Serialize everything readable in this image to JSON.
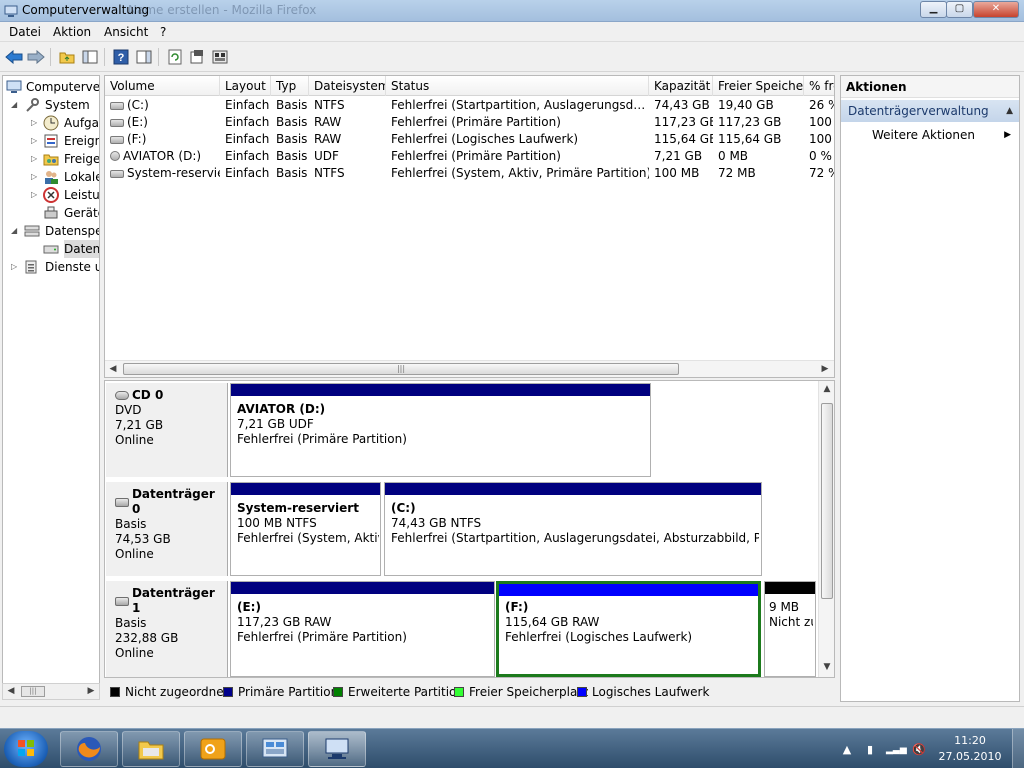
{
  "window": {
    "title": "Computerverwaltung",
    "title_ghost": "Name erstellen - Mozilla Firefox",
    "min_symbol": "▁",
    "max_symbol": "▢",
    "close_symbol": "✕"
  },
  "menu": [
    "Datei",
    "Aktion",
    "Ansicht",
    "?"
  ],
  "toolbar": {
    "icons": [
      "back-icon",
      "forward-icon",
      "up-folder-icon",
      "show-hide-tree-icon",
      "help-icon",
      "show-hide-action-pane-icon",
      "refresh-icon",
      "properties-icon",
      "console-icon"
    ]
  },
  "tree": {
    "items": [
      {
        "label": "Computerverwaltung (Lokal)",
        "icon": "computer-management-icon",
        "level": 0,
        "expander": ""
      },
      {
        "label": "System",
        "icon": "tools-icon",
        "level": 1,
        "expander": "◢"
      },
      {
        "label": "Aufgabenplanung",
        "icon": "clock-icon",
        "level": 2,
        "expander": "▷"
      },
      {
        "label": "Ereignisanzeige",
        "icon": "event-viewer-icon",
        "level": 2,
        "expander": "▷"
      },
      {
        "label": "Freigegebene Ordner",
        "icon": "shared-folder-icon",
        "level": 2,
        "expander": "▷"
      },
      {
        "label": "Lokale Benutzer und Gruppen",
        "icon": "users-icon",
        "level": 2,
        "expander": "▷"
      },
      {
        "label": "Leistung",
        "icon": "performance-icon",
        "level": 2,
        "expander": "▷"
      },
      {
        "label": "Geräte-Manager",
        "icon": "device-manager-icon",
        "level": 2,
        "expander": ""
      },
      {
        "label": "Datenspeicher",
        "icon": "storage-icon",
        "level": 1,
        "expander": "◢"
      },
      {
        "label": "Datenträgerverwaltung",
        "icon": "disk-management-icon",
        "level": 2,
        "expander": "",
        "selected": true
      },
      {
        "label": "Dienste und Anwendungen",
        "icon": "services-icon",
        "level": 1,
        "expander": "▷"
      }
    ]
  },
  "volume_list": {
    "columns": [
      "Volume",
      "Layout",
      "Typ",
      "Dateisystem",
      "Status",
      "Kapazität",
      "Freier Speicher",
      "% frei"
    ],
    "rows": [
      [
        "(C:)",
        "Einfach",
        "Basis",
        "NTFS",
        "Fehlerfrei (Startpartition, Auslagerungsdatei, Absturzabbild, Primäre Partition)",
        "74,43 GB",
        "19,40 GB",
        "26 %"
      ],
      [
        "(E:)",
        "Einfach",
        "Basis",
        "RAW",
        "Fehlerfrei (Primäre Partition)",
        "117,23 GB",
        "117,23 GB",
        "100 %"
      ],
      [
        "(F:)",
        "Einfach",
        "Basis",
        "RAW",
        "Fehlerfrei (Logisches Laufwerk)",
        "115,64 GB",
        "115,64 GB",
        "100 %"
      ],
      [
        "AVIATOR (D:)",
        "Einfach",
        "Basis",
        "UDF",
        "Fehlerfrei (Primäre Partition)",
        "7,21 GB",
        "0 MB",
        "0 %"
      ],
      [
        "System-reserviert",
        "Einfach",
        "Basis",
        "NTFS",
        "Fehlerfrei (System, Aktiv, Primäre Partition)",
        "100 MB",
        "72 MB",
        "72 %"
      ]
    ],
    "scroll_grip": "|||"
  },
  "disks": [
    {
      "name": "CD 0",
      "type": "DVD",
      "size": "7,21 GB",
      "state": "Online",
      "icon": "cd-drive-icon",
      "partitions": [
        {
          "name": "AVIATOR  (D:)",
          "detail": "7,21 GB UDF",
          "status": "Fehlerfrei (Primäre Partition)",
          "kind": "primary"
        }
      ]
    },
    {
      "name": "Datenträger 0",
      "type": "Basis",
      "size": "74,53 GB",
      "state": "Online",
      "icon": "hard-disk-icon",
      "partitions": [
        {
          "name": "System-reserviert",
          "detail": "100 MB NTFS",
          "status": "Fehlerfrei (System, Aktiv, Primäre Partition)",
          "kind": "primary"
        },
        {
          "name": "(C:)",
          "detail": "74,43 GB NTFS",
          "status": "Fehlerfrei (Startpartition, Auslagerungsdatei, Absturzabbild, Primäre Partition)",
          "kind": "primary"
        }
      ]
    },
    {
      "name": "Datenträger 1",
      "type": "Basis",
      "size": "232,88 GB",
      "state": "Online",
      "icon": "hard-disk-icon",
      "partitions": [
        {
          "name": "(E:)",
          "detail": "117,23 GB RAW",
          "status": "Fehlerfrei (Primäre Partition)",
          "kind": "primary"
        },
        {
          "name": "(F:)",
          "detail": "115,64 GB RAW",
          "status": "Fehlerfrei (Logisches Laufwerk)",
          "kind": "logical",
          "selected": true
        },
        {
          "name": "",
          "detail": "9 MB",
          "status": "Nicht zugeordnet",
          "kind": "unallocated"
        }
      ]
    }
  ],
  "legend": [
    {
      "label": "Nicht zugeordnet",
      "color": "#000000"
    },
    {
      "label": "Primäre Partition",
      "color": "#00008b"
    },
    {
      "label": "Erweiterte Partition",
      "color": "#008000"
    },
    {
      "label": "Freier Speicherplatz",
      "color": "#33ff33"
    },
    {
      "label": "Logisches Laufwerk",
      "color": "#0000ff"
    }
  ],
  "colors": {
    "primary": "#00007f",
    "logical": "#0000ff",
    "unallocated": "#000000",
    "selection": "#1c7a1c"
  },
  "actions": {
    "title": "Aktionen",
    "section": "Datenträgerverwaltung",
    "section_caret": "▲",
    "item": "Weitere Aktionen",
    "item_arrow": "▶"
  },
  "taskbar": {
    "apps": [
      "firefox-icon",
      "explorer-icon",
      "outlook-icon",
      "control-panel-icon",
      "computer-management-icon"
    ],
    "tray_icons": [
      "show-hidden-icons-icon",
      "network-device-icon",
      "signal-icon",
      "volume-muted-icon"
    ],
    "tray_symbols": [
      "▲",
      "▮",
      "▂▃▅",
      "🔇"
    ],
    "time": "11:20",
    "date": "27.05.2010"
  }
}
